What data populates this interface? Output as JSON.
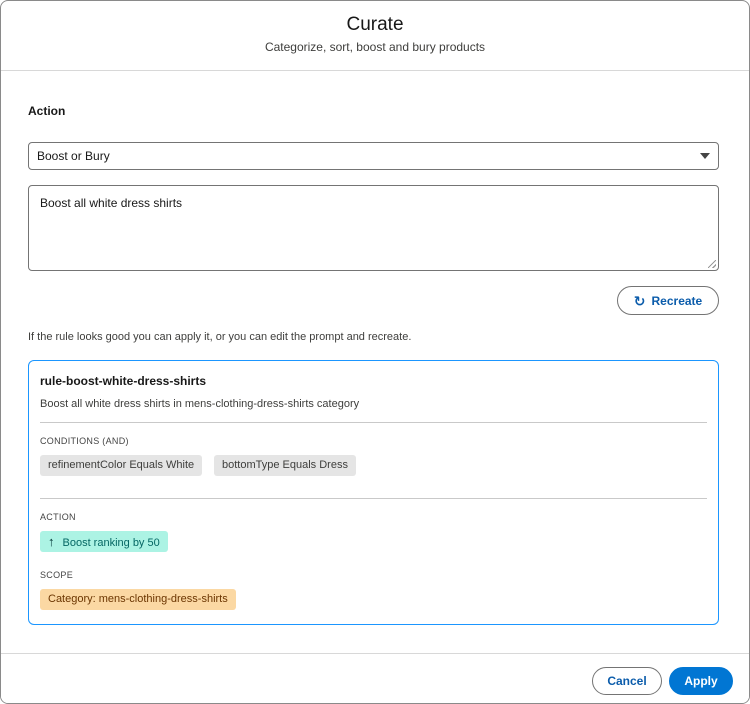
{
  "header": {
    "title": "Curate",
    "subtitle": "Categorize, sort, boost and bury products"
  },
  "form": {
    "action_label": "Action",
    "action_select_value": "Boost or Bury",
    "prompt_value": "Boost all white dress shirts",
    "recreate_label": "Recreate",
    "hint": "If the rule looks good you can apply it, or you can edit the prompt and recreate."
  },
  "rule": {
    "name": "rule-boost-white-dress-shirts",
    "description": "Boost all white dress shirts in mens-clothing-dress-shirts category",
    "conditions_label": "CONDITIONS (AND)",
    "conditions": [
      "refinementColor Equals White",
      "bottomType Equals Dress"
    ],
    "action_label": "ACTION",
    "action_value": "Boost ranking by 50",
    "scope_label": "SCOPE",
    "scope_value": "Category: mens-clothing-dress-shirts"
  },
  "footer": {
    "cancel_label": "Cancel",
    "apply_label": "Apply"
  },
  "icons": {
    "recreate": "refresh-icon",
    "boost": "arrow-up-icon",
    "dropdown": "chevron-down-icon"
  },
  "colors": {
    "brand_blue": "#0176d3",
    "link_blue": "#0b5cab",
    "card_border": "#1b96ff",
    "action_pill": "#acf3e4",
    "scope_pill": "#fbd8a3"
  }
}
